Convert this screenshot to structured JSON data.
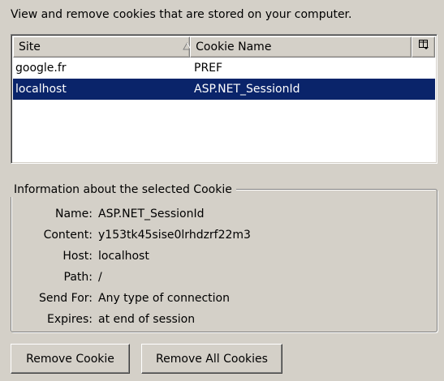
{
  "intro_text": "View and remove cookies that are stored on your computer.",
  "cookie_list": {
    "columns": {
      "site": "Site",
      "cookie_name": "Cookie Name"
    },
    "sort_indicator": "ascending",
    "column_picker_icon": "column-picker-icon",
    "rows": [
      {
        "site": "google.fr",
        "cookie_name": "PREF",
        "selected": false
      },
      {
        "site": "localhost",
        "cookie_name": "ASP.NET_SessionId",
        "selected": true
      }
    ]
  },
  "info": {
    "title": "Information about the selected Cookie",
    "name_label": "Name:",
    "name_value": "ASP.NET_SessionId",
    "content_label": "Content:",
    "content_value": "y153tk45sise0lrhdzrf22m3",
    "host_label": "Host:",
    "host_value": "localhost",
    "path_label": "Path:",
    "path_value": "/",
    "send_for_label": "Send For:",
    "send_for_value": "Any type of connection",
    "expires_label": "Expires:",
    "expires_value": "at end of session"
  },
  "buttons": {
    "remove_cookie": "Remove Cookie",
    "remove_all_cookies": "Remove All Cookies"
  },
  "colors": {
    "dialog_background": "#d4d0c8",
    "selection_background": "#0a246a",
    "selection_text": "#ffffff",
    "list_background": "#ffffff"
  }
}
